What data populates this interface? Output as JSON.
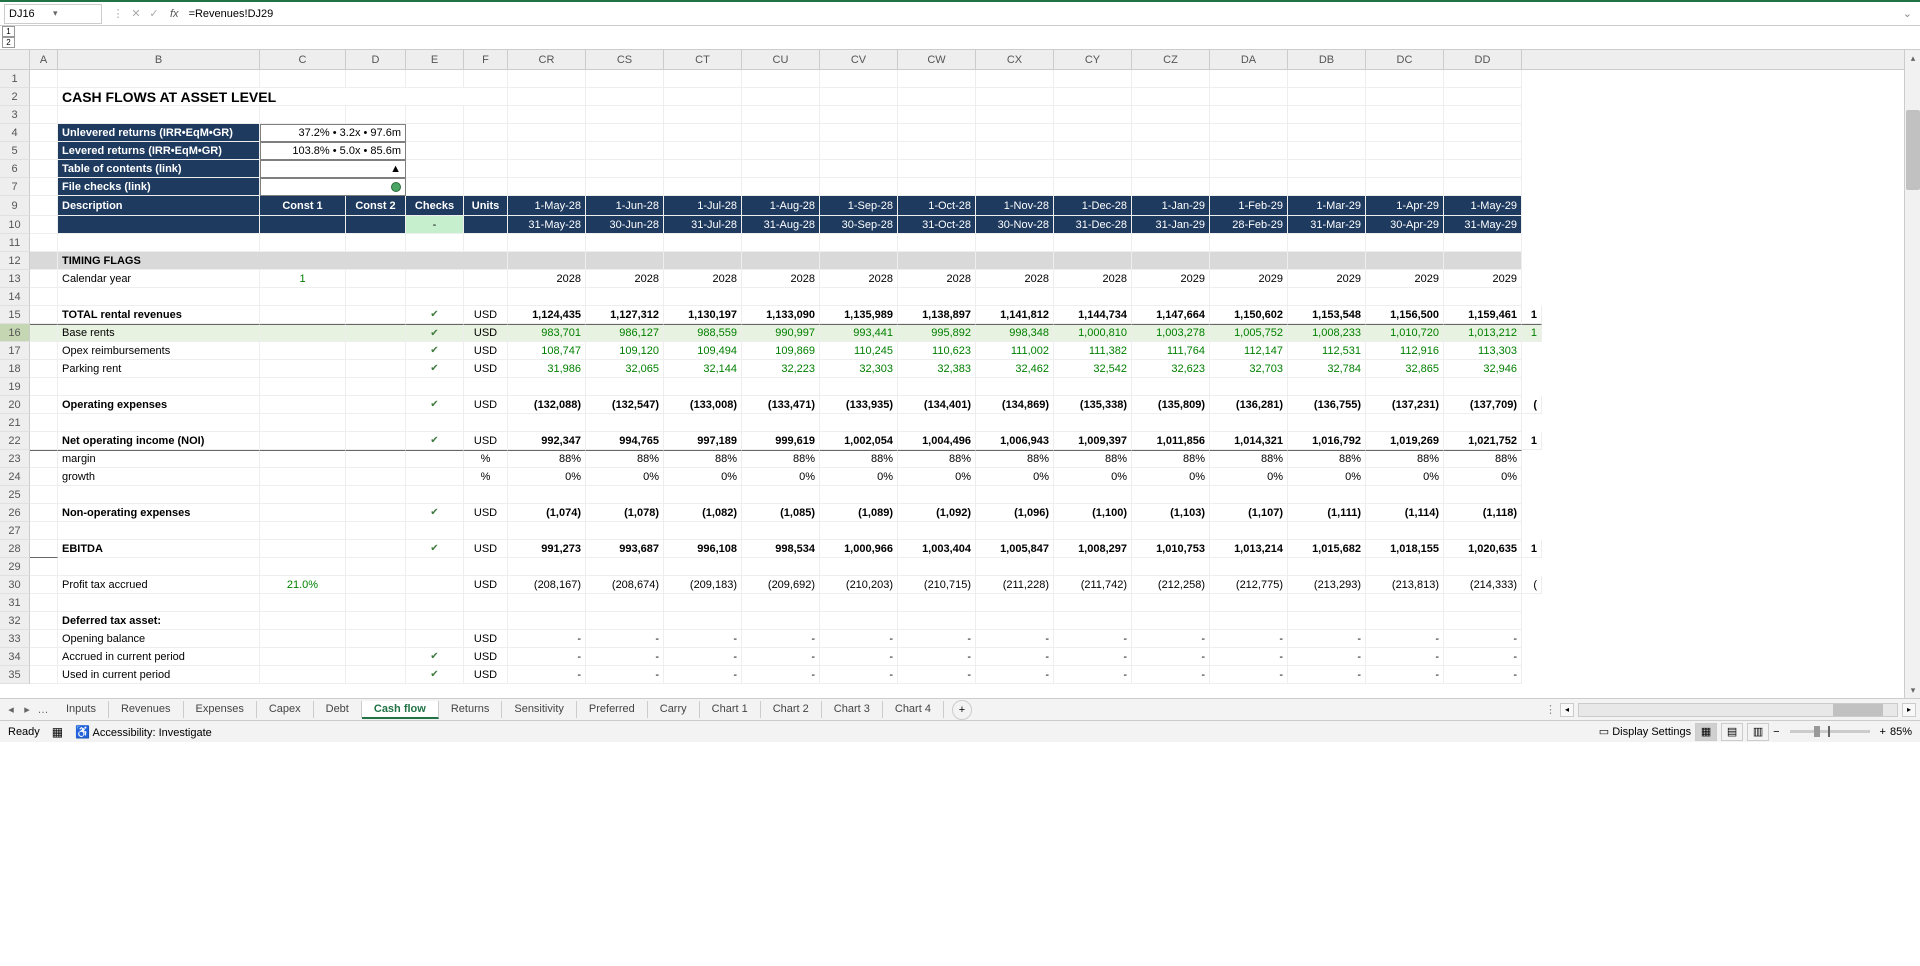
{
  "formula_bar": {
    "cell_ref": "DJ16",
    "formula": "=Revenues!DJ29",
    "fx_label": "fx"
  },
  "outline": {
    "lvl1": "1",
    "lvl2": "2"
  },
  "columns_visible": [
    "A",
    "B",
    "C",
    "D",
    "E",
    "F",
    "CR",
    "CS",
    "CT",
    "CU",
    "CV",
    "CW",
    "CX",
    "CY",
    "CZ",
    "DA",
    "DB",
    "DC",
    "DD"
  ],
  "col_widths": {
    "A": 28,
    "B": 202,
    "C": 86,
    "D": 60,
    "E": 58,
    "F": 44,
    "data": 78
  },
  "title": "CASH FLOWS AT ASSET LEVEL",
  "summary": {
    "r4_label": "Unlevered returns (IRR•EqM•GR)",
    "r4_val": "37.2% • 3.2x • 97.6m",
    "r5_label": "Levered returns (IRR•EqM•GR)",
    "r5_val": "103.8% • 5.0x • 85.6m",
    "r6_label": "Table of contents (link)",
    "r6_icon": "▲",
    "r7_label": "File checks (link)"
  },
  "header_row": {
    "description": "Description",
    "const1": "Const 1",
    "const2": "Const 2",
    "checks": "Checks",
    "units": "Units",
    "dash": "-",
    "start_dates": [
      "1-May-28",
      "1-Jun-28",
      "1-Jul-28",
      "1-Aug-28",
      "1-Sep-28",
      "1-Oct-28",
      "1-Nov-28",
      "1-Dec-28",
      "1-Jan-29",
      "1-Feb-29",
      "1-Mar-29",
      "1-Apr-29",
      "1-May-29"
    ],
    "end_dates": [
      "31-May-28",
      "30-Jun-28",
      "31-Jul-28",
      "31-Aug-28",
      "30-Sep-28",
      "31-Oct-28",
      "30-Nov-28",
      "31-Dec-28",
      "31-Jan-29",
      "28-Feb-29",
      "31-Mar-29",
      "30-Apr-29",
      "31-May-29"
    ]
  },
  "rows": {
    "timing_flags": "TIMING FLAGS",
    "cal_year": {
      "label": "Calendar year",
      "const1": "1",
      "data": [
        "2028",
        "2028",
        "2028",
        "2028",
        "2028",
        "2028",
        "2028",
        "2028",
        "2029",
        "2029",
        "2029",
        "2029",
        "2029"
      ]
    },
    "total_rev": {
      "label": "TOTAL rental revenues",
      "units": "USD",
      "data": [
        "1,124,435",
        "1,127,312",
        "1,130,197",
        "1,133,090",
        "1,135,989",
        "1,138,897",
        "1,141,812",
        "1,144,734",
        "1,147,664",
        "1,150,602",
        "1,153,548",
        "1,156,500",
        "1,159,461"
      ],
      "trail": "1"
    },
    "base_rents": {
      "label": "Base rents",
      "units": "USD",
      "data": [
        "983,701",
        "986,127",
        "988,559",
        "990,997",
        "993,441",
        "995,892",
        "998,348",
        "1,000,810",
        "1,003,278",
        "1,005,752",
        "1,008,233",
        "1,010,720",
        "1,013,212"
      ],
      "trail": "1"
    },
    "opex_reimb": {
      "label": "Opex reimbursements",
      "units": "USD",
      "data": [
        "108,747",
        "109,120",
        "109,494",
        "109,869",
        "110,245",
        "110,623",
        "111,002",
        "111,382",
        "111,764",
        "112,147",
        "112,531",
        "112,916",
        "113,303"
      ]
    },
    "parking": {
      "label": "Parking rent",
      "units": "USD",
      "data": [
        "31,986",
        "32,065",
        "32,144",
        "32,223",
        "32,303",
        "32,383",
        "32,462",
        "32,542",
        "32,623",
        "32,703",
        "32,784",
        "32,865",
        "32,946"
      ]
    },
    "op_exp": {
      "label": "Operating expenses",
      "units": "USD",
      "data": [
        "(132,088)",
        "(132,547)",
        "(133,008)",
        "(133,471)",
        "(133,935)",
        "(134,401)",
        "(134,869)",
        "(135,338)",
        "(135,809)",
        "(136,281)",
        "(136,755)",
        "(137,231)",
        "(137,709)"
      ],
      "trail": "("
    },
    "noi": {
      "label": "Net operating income (NOI)",
      "units": "USD",
      "data": [
        "992,347",
        "994,765",
        "997,189",
        "999,619",
        "1,002,054",
        "1,004,496",
        "1,006,943",
        "1,009,397",
        "1,011,856",
        "1,014,321",
        "1,016,792",
        "1,019,269",
        "1,021,752"
      ],
      "trail": "1"
    },
    "margin": {
      "label": "margin",
      "units": "%",
      "data": [
        "88%",
        "88%",
        "88%",
        "88%",
        "88%",
        "88%",
        "88%",
        "88%",
        "88%",
        "88%",
        "88%",
        "88%",
        "88%"
      ]
    },
    "growth": {
      "label": "growth",
      "units": "%",
      "data": [
        "0%",
        "0%",
        "0%",
        "0%",
        "0%",
        "0%",
        "0%",
        "0%",
        "0%",
        "0%",
        "0%",
        "0%",
        "0%"
      ]
    },
    "non_op": {
      "label": "Non-operating expenses",
      "units": "USD",
      "data": [
        "(1,074)",
        "(1,078)",
        "(1,082)",
        "(1,085)",
        "(1,089)",
        "(1,092)",
        "(1,096)",
        "(1,100)",
        "(1,103)",
        "(1,107)",
        "(1,111)",
        "(1,114)",
        "(1,118)"
      ]
    },
    "ebitda": {
      "label": "EBITDA",
      "units": "USD",
      "data": [
        "991,273",
        "993,687",
        "996,108",
        "998,534",
        "1,000,966",
        "1,003,404",
        "1,005,847",
        "1,008,297",
        "1,010,753",
        "1,013,214",
        "1,015,682",
        "1,018,155",
        "1,020,635"
      ],
      "trail": "1"
    },
    "profit_tax": {
      "label": "Profit tax accrued",
      "const1": "21.0%",
      "units": "USD",
      "data": [
        "(208,167)",
        "(208,674)",
        "(209,183)",
        "(209,692)",
        "(210,203)",
        "(210,715)",
        "(211,228)",
        "(211,742)",
        "(212,258)",
        "(212,775)",
        "(213,293)",
        "(213,813)",
        "(214,333)"
      ],
      "trail": "("
    },
    "dta": "Deferred tax asset:",
    "open_bal": {
      "label": "Opening balance",
      "units": "USD",
      "data": [
        "-",
        "-",
        "-",
        "-",
        "-",
        "-",
        "-",
        "-",
        "-",
        "-",
        "-",
        "-",
        "-"
      ]
    },
    "accrued": {
      "label": "Accrued in current period",
      "units": "USD",
      "data": [
        "-",
        "-",
        "-",
        "-",
        "-",
        "-",
        "-",
        "-",
        "-",
        "-",
        "-",
        "-",
        "-"
      ]
    },
    "used": {
      "label": "Used in current period",
      "units": "USD",
      "data": [
        "-",
        "-",
        "-",
        "-",
        "-",
        "-",
        "-",
        "-",
        "-",
        "-",
        "-",
        "-",
        "-"
      ]
    }
  },
  "tabs": [
    "Inputs",
    "Revenues",
    "Expenses",
    "Capex",
    "Debt",
    "Cash flow",
    "Returns",
    "Sensitivity",
    "Preferred",
    "Carry",
    "Chart 1",
    "Chart 2",
    "Chart 3",
    "Chart 4"
  ],
  "active_tab": "Cash flow",
  "status": {
    "ready": "Ready",
    "accessibility": "Accessibility: Investigate",
    "display_settings": "Display Settings",
    "zoom": "85%",
    "plus": "+"
  }
}
